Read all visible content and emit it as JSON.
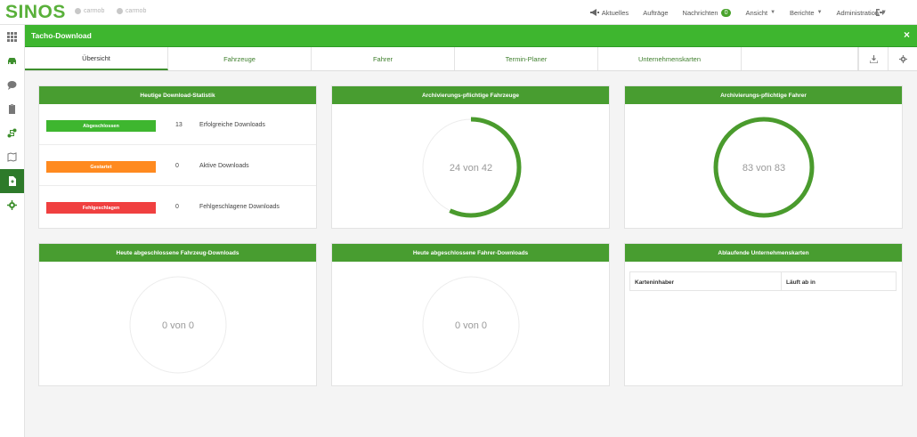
{
  "topbar": {
    "logo": "SINOS",
    "user1": "carmob",
    "user2": "carmob",
    "nav": {
      "aktuelles": "Aktuelles",
      "auftraege": "Aufträge",
      "nachrichten": "Nachrichten",
      "nachrichten_count": "0",
      "ansicht": "Ansicht",
      "berichte": "Berichte",
      "administration": "Administration"
    }
  },
  "appbar": {
    "title": "Tacho-Download",
    "close": "×"
  },
  "tabs": [
    {
      "label": "Übersicht"
    },
    {
      "label": "Fahrzeuge"
    },
    {
      "label": "Fahrer"
    },
    {
      "label": "Termin-Planer"
    },
    {
      "label": "Unternehmenskarten"
    }
  ],
  "colors": {
    "green": "#3eb62f",
    "panel_header": "#489d30",
    "done": "#3eb62f",
    "started": "#ff8a1f",
    "failed": "#f04040",
    "ring": "#4a9b2d",
    "ring_track": "#ececec"
  },
  "panels": {
    "stats": {
      "title": "Heutige Download-Statistik",
      "rows": [
        {
          "badge": "Abgeschlossen",
          "count": "13",
          "label": "Erfolgreiche Downloads"
        },
        {
          "badge": "Gestartet",
          "count": "0",
          "label": "Aktive Downloads"
        },
        {
          "badge": "Fehlgeschlagen",
          "count": "0",
          "label": "Fehlgeschlagene Downloads"
        }
      ]
    },
    "vehicles": {
      "title": "Archivierungs-pflichtige Fahrzeuge",
      "text": "24 von 42",
      "value": 24,
      "total": 42
    },
    "drivers": {
      "title": "Archivierungs-pflichtige Fahrer",
      "text": "83 von 83",
      "value": 83,
      "total": 83
    },
    "vehicle_dl": {
      "title": "Heute abgeschlossene Fahrzeug-Downloads",
      "text": "0 von 0",
      "value": 0,
      "total": 0
    },
    "driver_dl": {
      "title": "Heute abgeschlossene Fahrer-Downloads",
      "text": "0 von 0",
      "value": 0,
      "total": 0
    },
    "cards": {
      "title": "Ablaufende Unternehmenskarten",
      "col1": "Karteninhaber",
      "col2": "Läuft ab in"
    }
  }
}
